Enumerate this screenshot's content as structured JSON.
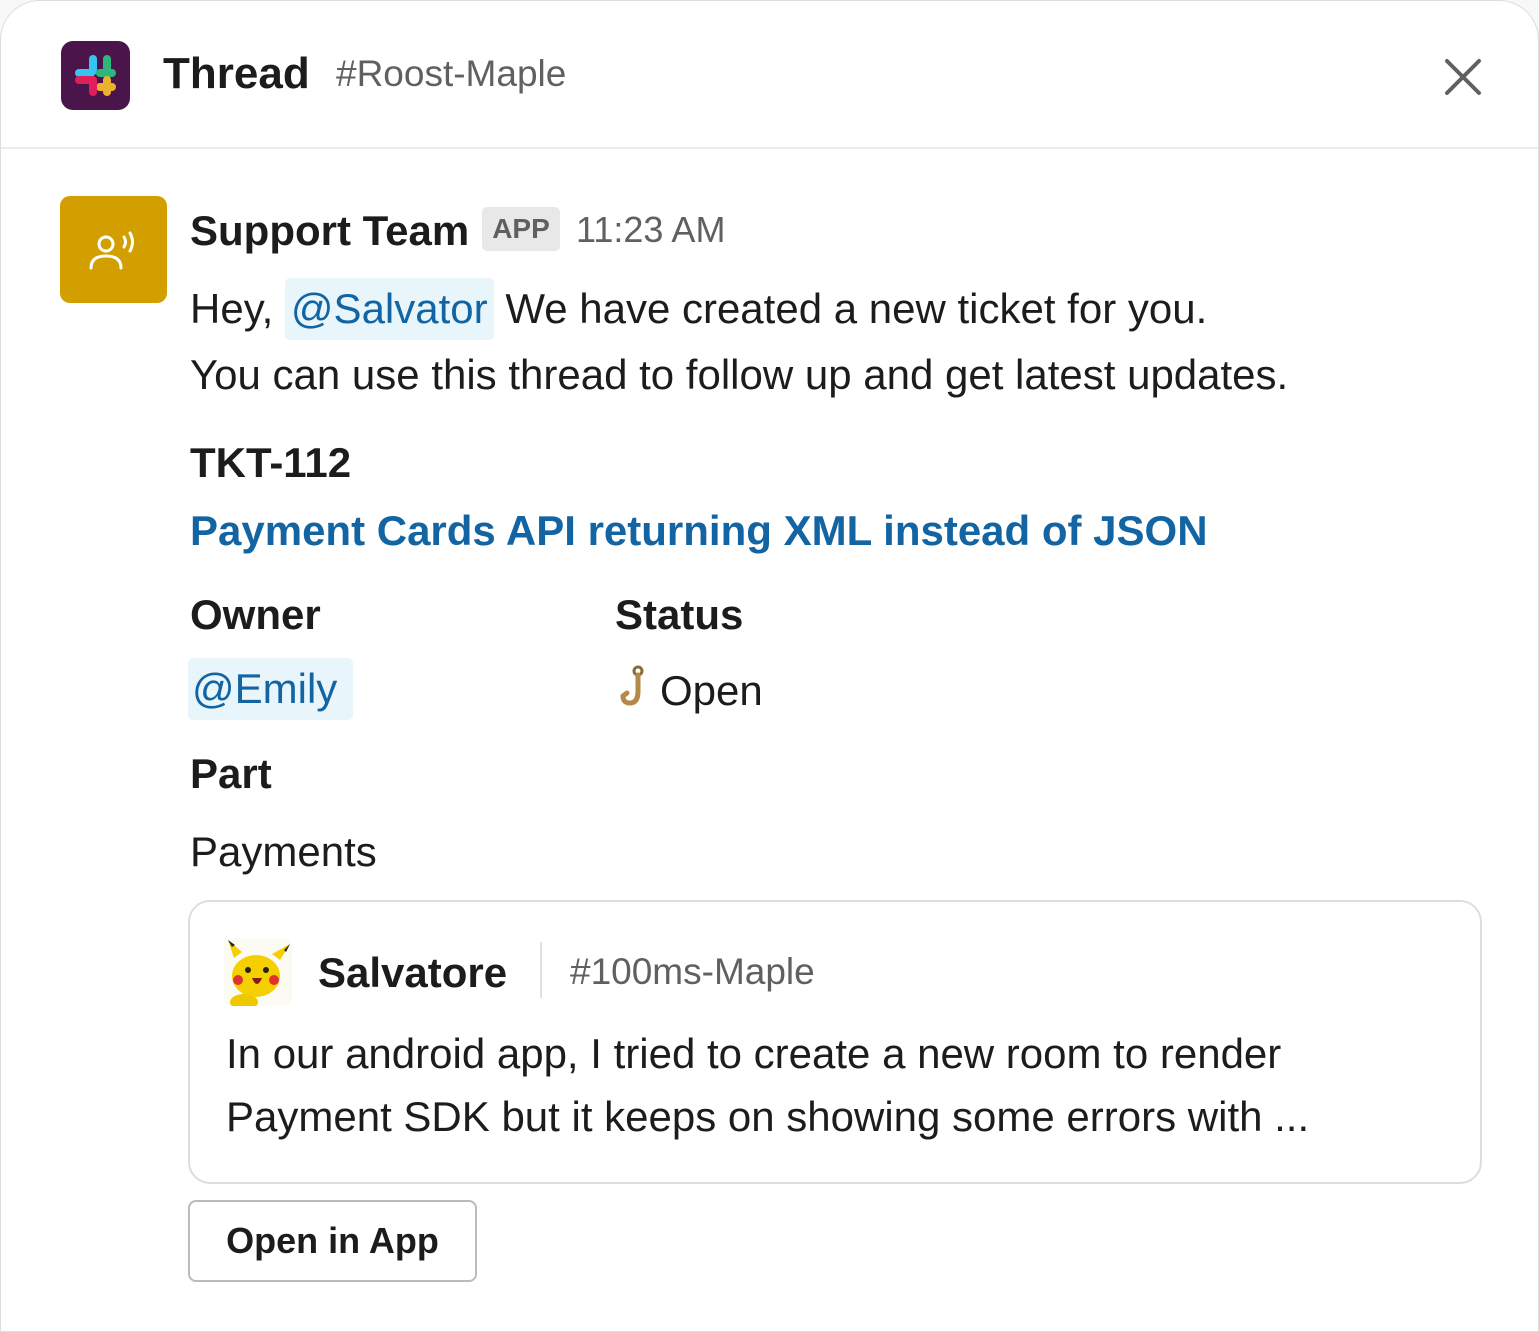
{
  "header": {
    "title": "Thread",
    "channel": "#Roost-Maple",
    "logo_icon": "slack-logo-icon",
    "close_icon": "close-icon"
  },
  "message": {
    "sender": "Support Team",
    "badge": "APP",
    "time": "11:23 AM",
    "avatar_icon": "support-agent-icon",
    "avatar_color": "#d39e00",
    "line1_prefix": "Hey,",
    "line1_mention": "@Salvator",
    "line1_suffix": "We have created a new ticket for you.",
    "line2": "You can use this thread to follow up and get latest updates."
  },
  "ticket": {
    "id": "TKT-112",
    "title": "Payment Cards API returning XML instead of JSON",
    "owner_label": "Owner",
    "owner_value": "@Emily",
    "status_label": "Status",
    "status_icon": "hook-icon",
    "status_value": "Open",
    "part_label": "Part",
    "part_value": "Payments"
  },
  "quote": {
    "author": "Salvatore",
    "channel": "#100ms-Maple",
    "avatar_icon": "pikachu-avatar-icon",
    "line1": "In our android app, I tried to create a new room to render",
    "line2": "Payment SDK but it keeps on showing some errors with ..."
  },
  "actions": {
    "open_in_app": "Open in App"
  },
  "colors": {
    "link": "#1264a3",
    "mention_bg": "#e8f5fa",
    "slack_purple": "#4a154b",
    "text": "#1d1c1d",
    "muted": "#616061"
  }
}
